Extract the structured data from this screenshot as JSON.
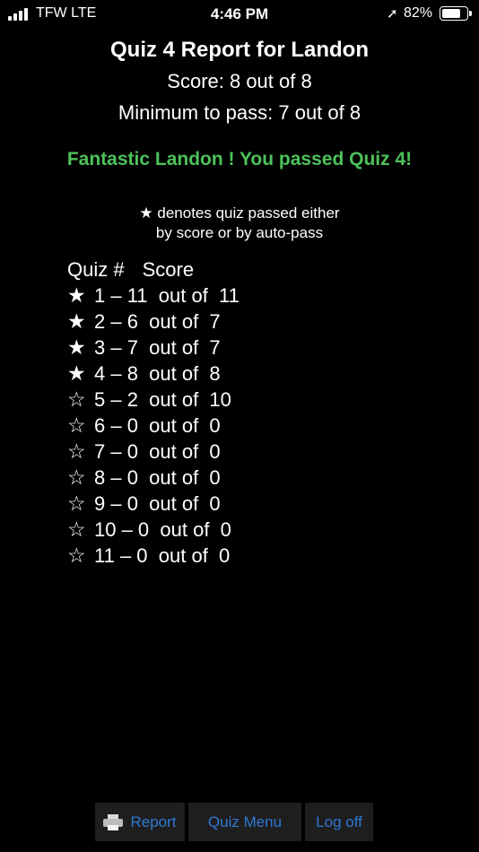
{
  "status_bar": {
    "carrier": "TFW  LTE",
    "time": "4:46 PM",
    "location_icon": "location-arrow-icon",
    "battery_percent": "82%",
    "battery_level": 0.82
  },
  "report": {
    "title": "Quiz 4 Report for Landon",
    "score": "Score: 8 out of 8",
    "minimum": "Minimum to pass: 7 out of 8",
    "success_message": "Fantastic Landon !  You passed Quiz 4!",
    "success_color": "#4ec15a",
    "legend_line1": "★ denotes quiz passed either",
    "legend_line2": "by score or by auto-pass"
  },
  "table": {
    "header_quiz": "Quiz #",
    "header_score": "Score",
    "rows": [
      {
        "star": "★",
        "text": "1 – 11  out of  11"
      },
      {
        "star": "★",
        "text": "2 – 6  out of  7"
      },
      {
        "star": "★",
        "text": "3 – 7  out of  7"
      },
      {
        "star": "★",
        "text": "4 – 8  out of  8"
      },
      {
        "star": "☆",
        "text": "5 – 2  out of  10"
      },
      {
        "star": "☆",
        "text": "6 – 0  out of  0"
      },
      {
        "star": "☆",
        "text": "7 – 0  out of  0"
      },
      {
        "star": "☆",
        "text": "8 – 0  out of  0"
      },
      {
        "star": "☆",
        "text": "9 – 0  out of  0"
      },
      {
        "star": "☆",
        "text": "10 – 0  out of  0"
      },
      {
        "star": "☆",
        "text": "11 – 0  out of  0"
      }
    ]
  },
  "toolbar": {
    "report_label": "Report",
    "report_icon": "printer-icon",
    "quiz_menu_label": "Quiz Menu",
    "logoff_label": "Log off",
    "link_color": "#2f78d4"
  }
}
